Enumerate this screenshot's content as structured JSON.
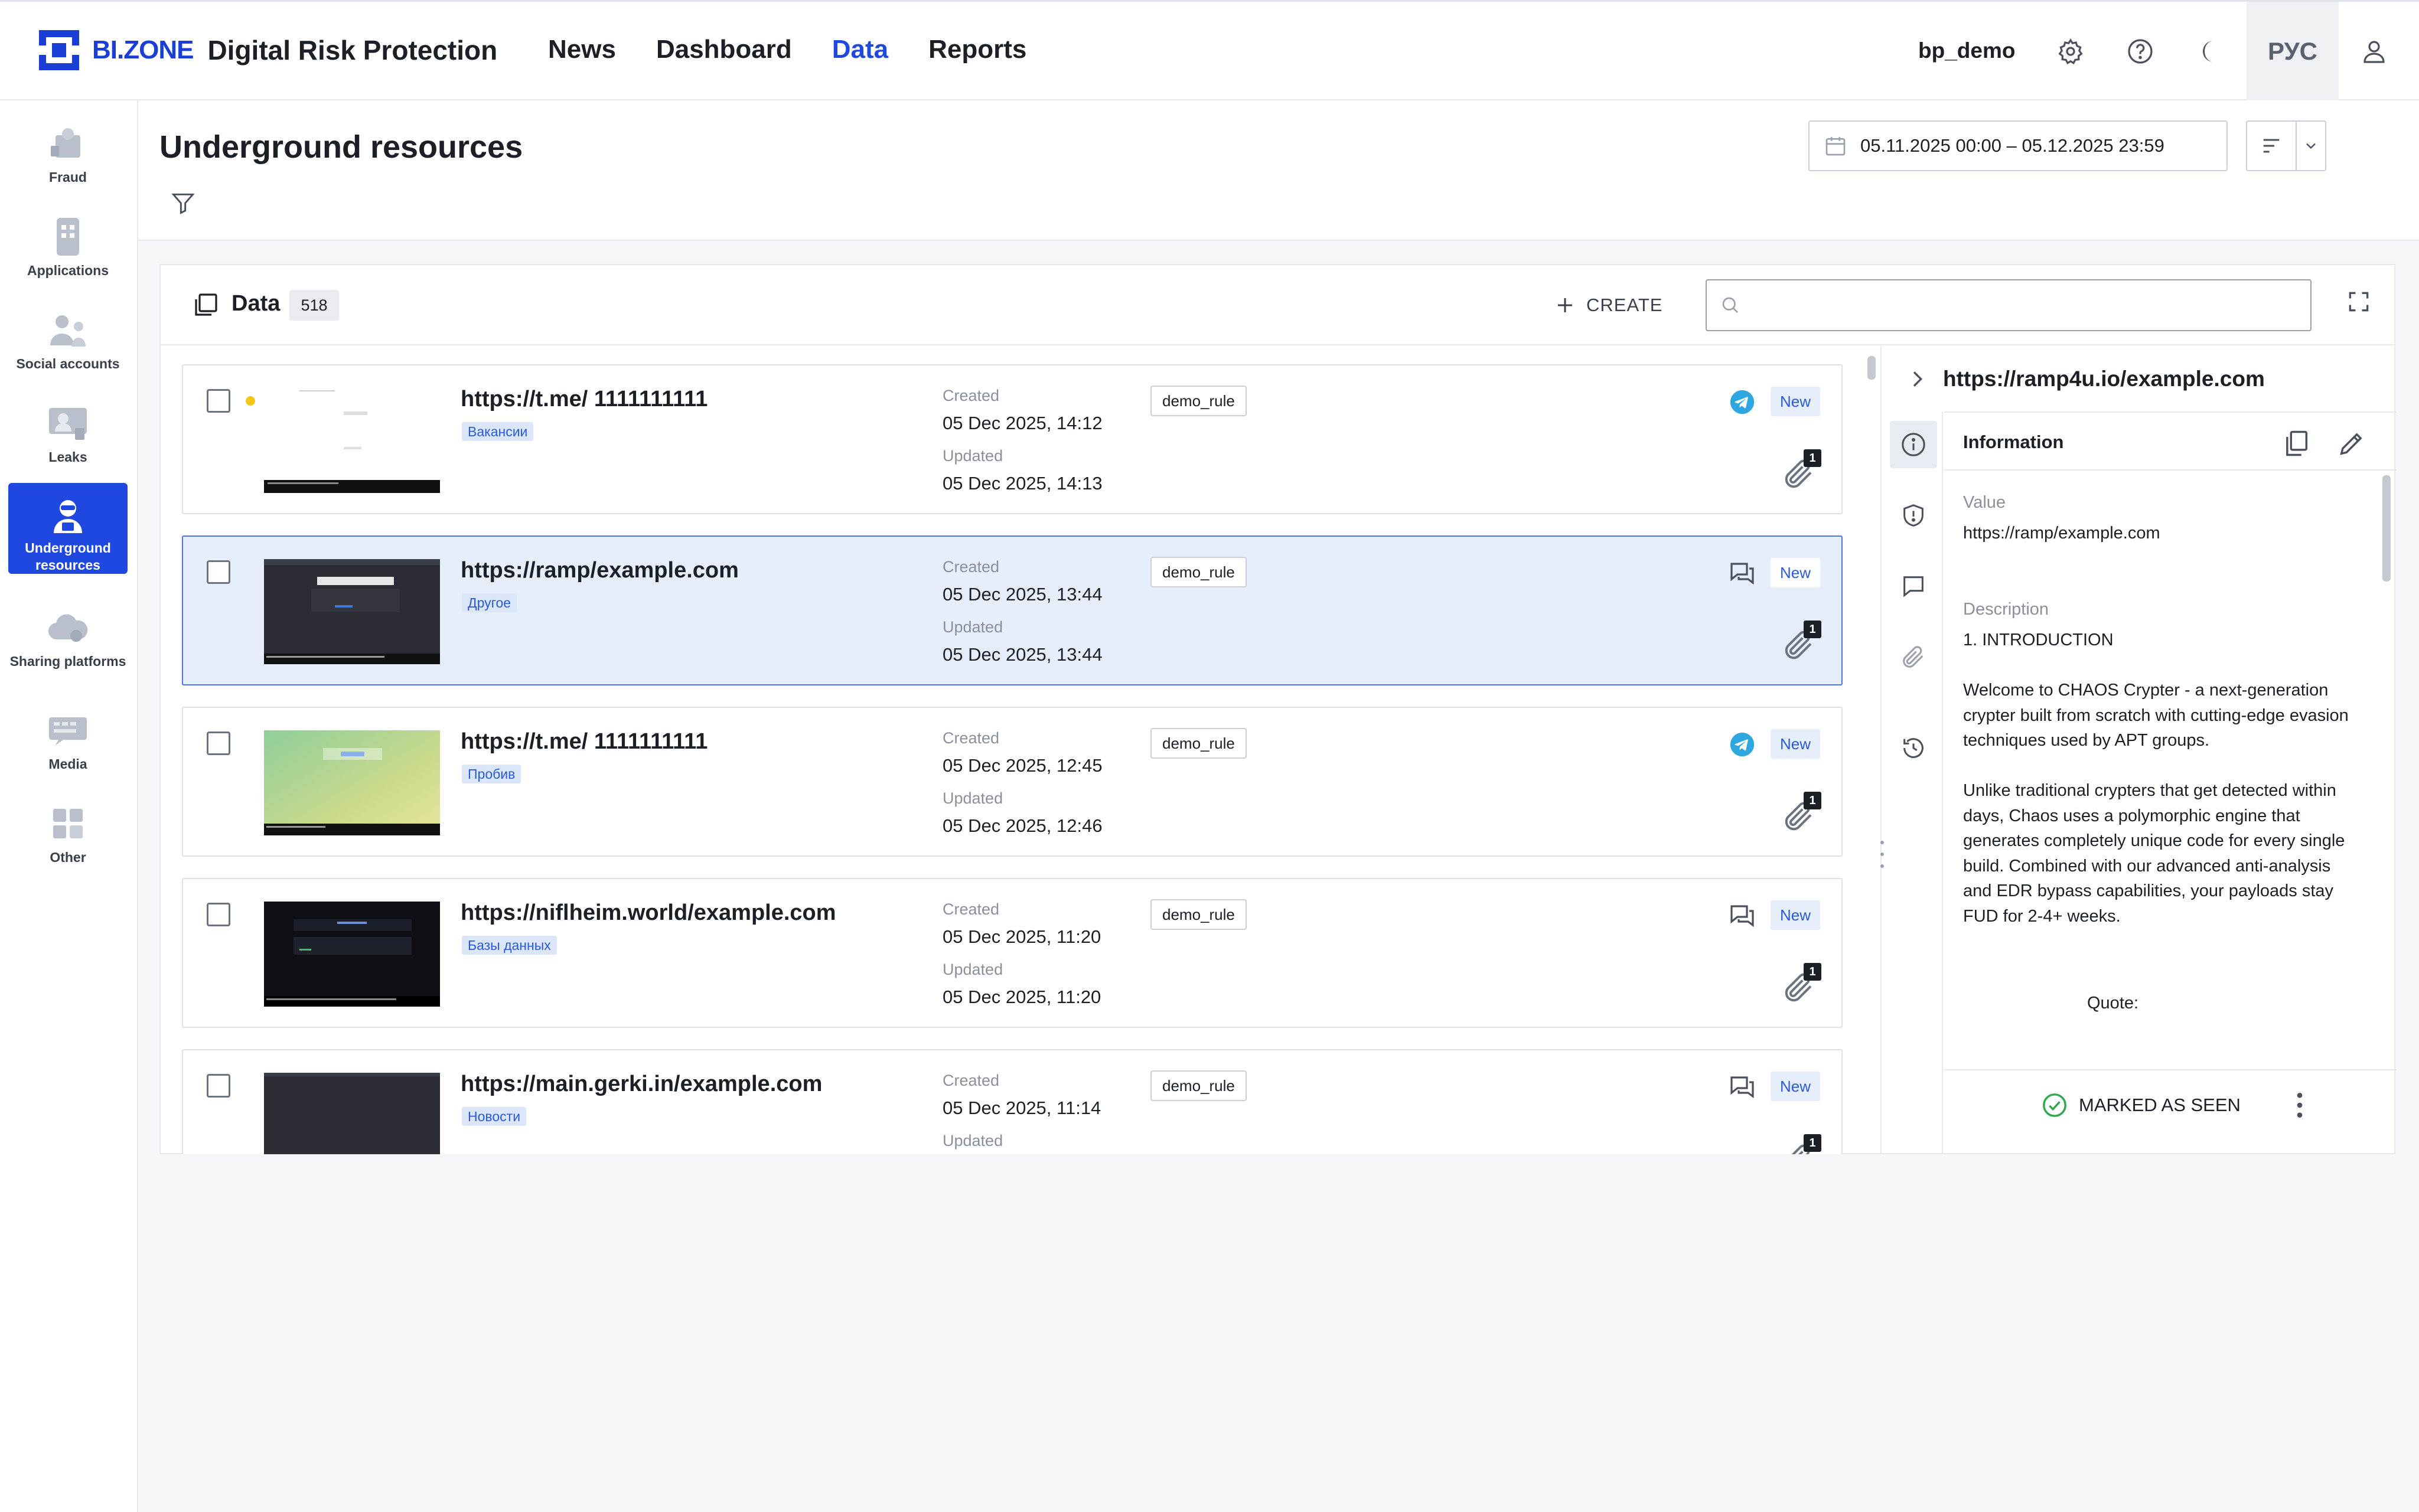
{
  "brand": {
    "name": "BI.ZONE",
    "product": "Digital Risk Protection"
  },
  "nav": {
    "items": [
      "News",
      "Dashboard",
      "Data",
      "Reports"
    ],
    "active": "Data"
  },
  "user": {
    "name": "bp_demo",
    "language": "РУС"
  },
  "sidebar": {
    "items": [
      {
        "label": "Fraud",
        "icon": "fraud-icon"
      },
      {
        "label": "Applications",
        "icon": "applications-icon"
      },
      {
        "label": "Social accounts",
        "icon": "social-accounts-icon"
      },
      {
        "label": "Leaks",
        "icon": "leaks-icon"
      },
      {
        "label": "Underground resources",
        "icon": "underground-icon",
        "active": true
      },
      {
        "label": "Sharing platforms",
        "icon": "cloud-icon"
      },
      {
        "label": "Media",
        "icon": "media-icon"
      },
      {
        "label": "Other",
        "icon": "grid-icon"
      }
    ]
  },
  "page": {
    "title": "Underground resources",
    "date_range": "05.11.2025 00:00 – 05.12.2025 23:59"
  },
  "panel": {
    "title": "Data",
    "count": "518",
    "create_label": "CREATE",
    "search_placeholder": ""
  },
  "labels": {
    "created": "Created",
    "updated": "Updated"
  },
  "rows": [
    {
      "url": "https://t.me/ 1111111111",
      "tag": "Вакансии",
      "created": "05 Dec 2025, 14:12",
      "updated": "05 Dec 2025, 14:13",
      "rule": "demo_rule",
      "source": "telegram-icon",
      "status": "New",
      "attachments": "1",
      "unread": true,
      "selected": false
    },
    {
      "url": "https://ramp/example.com",
      "tag": "Другое",
      "created": "05 Dec 2025, 13:44",
      "updated": "05 Dec 2025, 13:44",
      "rule": "demo_rule",
      "source": "forum-icon",
      "status": "New",
      "attachments": "1",
      "unread": false,
      "selected": true
    },
    {
      "url": "https://t.me/ 1111111111",
      "tag": "Пробив",
      "created": "05 Dec 2025, 12:45",
      "updated": "05 Dec 2025, 12:46",
      "rule": "demo_rule",
      "source": "telegram-icon",
      "status": "New",
      "attachments": "1",
      "unread": false,
      "selected": false
    },
    {
      "url": "https://niflheim.world/example.com",
      "tag": "Базы данных",
      "created": "05 Dec 2025, 11:20",
      "updated": "05 Dec 2025, 11:20",
      "rule": "demo_rule",
      "source": "forum-icon",
      "status": "New",
      "attachments": "1",
      "unread": false,
      "selected": false
    },
    {
      "url": "https://main.gerki.in/example.com",
      "tag": "Новости",
      "created": "05 Dec 2025, 11:14",
      "updated": "",
      "rule": "demo_rule",
      "source": "forum-icon",
      "status": "New",
      "attachments": "1",
      "unread": false,
      "selected": false
    }
  ],
  "detail": {
    "url": "https://ramp4u.io/example.com",
    "section": "Information",
    "value_label": "Value",
    "value": "https://ramp/example.com",
    "description_label": "Description",
    "description": "1. INTRODUCTION\n\nWelcome to CHAOS Crypter - a next-generation crypter built from scratch with cutting-edge evasion techniques used by APT groups.\n\nUnlike traditional crypters that get detected within days, Chaos uses a polymorphic engine that generates completely unique code for every single build. Combined with our advanced anti-analysis and EDR bypass capabilities, your payloads stay FUD for 2-4+ weeks.",
    "quote": "Quote:",
    "marked_label": "MARKED AS SEEN"
  },
  "colors": {
    "accent": "#1f48e0",
    "selected_bg": "#e6eefb",
    "tag_bg": "#dbe6fb",
    "unread_dot": "#f5c518"
  }
}
